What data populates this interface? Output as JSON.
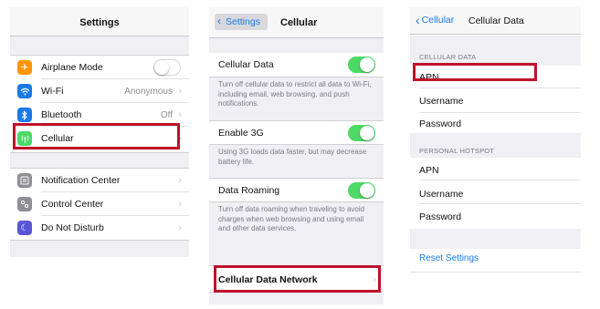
{
  "settings": {
    "title": "Settings",
    "items": [
      {
        "label": "Airplane Mode",
        "icon": "airplane-icon",
        "icon_color": "#ff9500"
      },
      {
        "label": "Wi-Fi",
        "value": "Anonymous",
        "icon": "wifi-icon",
        "icon_color": "#1a7ae8"
      },
      {
        "label": "Bluetooth",
        "value": "Off",
        "icon": "bluetooth-icon",
        "icon_color": "#1a7ae8"
      },
      {
        "label": "Cellular",
        "icon": "cellular-icon",
        "icon_color": "#4cd964"
      },
      {
        "label": "Notification Center",
        "icon": "notification-center-icon",
        "icon_color": "#8e8e93"
      },
      {
        "label": "Control Center",
        "icon": "control-center-icon",
        "icon_color": "#8e8e93"
      },
      {
        "label": "Do Not Disturb",
        "icon": "do-not-disturb-icon",
        "icon_color": "#5856d6"
      }
    ]
  },
  "cellular": {
    "back": "Settings",
    "title": "Cellular",
    "cellular_data": {
      "label": "Cellular Data",
      "on": true,
      "desc": "Turn off cellular data to restrict all data to Wi-Fi, including email, web browsing, and push notifications."
    },
    "enable_3g": {
      "label": "Enable 3G",
      "on": true,
      "desc": "Using 3G loads data faster, but may decrease battery life."
    },
    "data_roaming": {
      "label": "Data Roaming",
      "on": true,
      "desc": "Turn off data roaming when traveling to avoid charges when web browsing and using email and other data services."
    },
    "network": {
      "label": "Cellular Data Network"
    }
  },
  "cellular_data": {
    "back": "Cellular",
    "title": "Cellular Data",
    "section1": "CELLULAR DATA",
    "fields1": [
      "APN",
      "Username",
      "Password"
    ],
    "section2": "PERSONAL HOTSPOT",
    "fields2": [
      "APN",
      "Username",
      "Password"
    ],
    "reset": "Reset Settings"
  },
  "colors": {
    "highlight": "#c0122a",
    "accent": "#1a7ae8",
    "toggle_on": "#4cd964"
  }
}
